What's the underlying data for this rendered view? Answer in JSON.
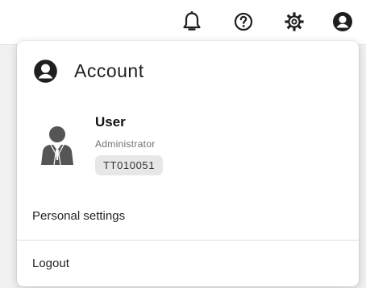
{
  "topbar": {
    "icons": [
      "bell-icon",
      "help-circle-icon",
      "gear-icon",
      "account-circle-icon"
    ]
  },
  "account_menu": {
    "title": "Account",
    "user": {
      "name": "User",
      "role": "Administrator",
      "id": "TT010051"
    },
    "items": [
      {
        "label": "Personal settings"
      },
      {
        "label": "Logout"
      }
    ]
  },
  "colors": {
    "icon": "#1f1f1f",
    "avatar": "#555555",
    "badge_bg": "#e7e7e7",
    "background": "#f0f0f0"
  }
}
